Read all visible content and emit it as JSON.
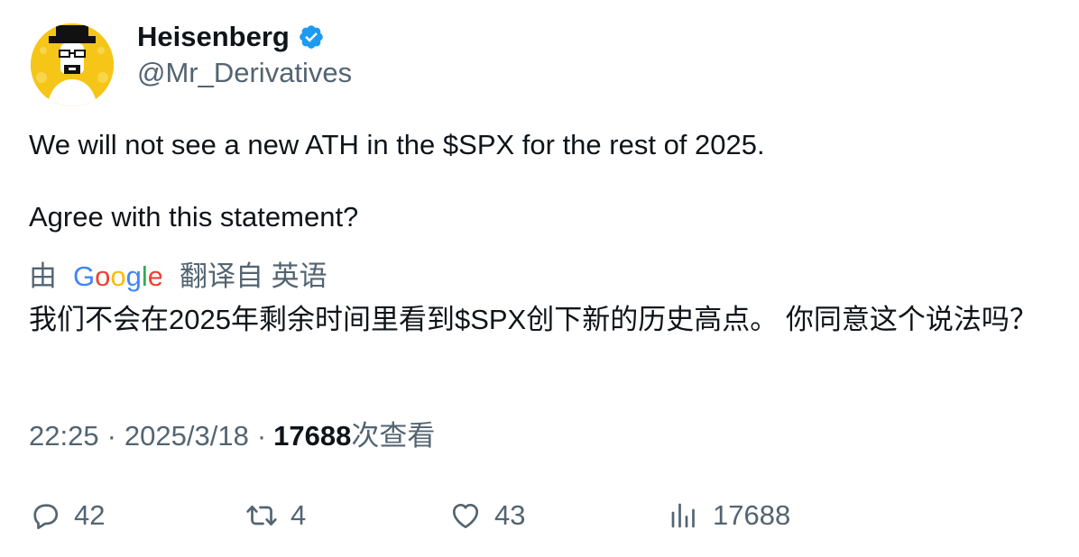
{
  "author": {
    "name": "Heisenberg",
    "handle": "@Mr_Derivatives",
    "verified_icon": "verified-badge-icon",
    "avatar_icon": "heisenberg-avatar",
    "verified_color": "#1d9bf0"
  },
  "tweet": {
    "text": "We will not see a new ATH in the $SPX for the rest of 2025.\n\nAgree with this statement?"
  },
  "translation": {
    "prefix": "由",
    "provider_logo": "Google",
    "suffix": "翻译自 英语",
    "text": "我们不会在2025年剩余时间里看到$SPX创下新的历史高点。 你同意这个说法吗？"
  },
  "meta": {
    "time": "22:25",
    "sep1": "·",
    "date": "2025/3/18",
    "sep2": "·",
    "views": "17688",
    "views_label": "次查看"
  },
  "actions": {
    "replies": "42",
    "retweets": "4",
    "likes": "43",
    "views": "17688"
  }
}
